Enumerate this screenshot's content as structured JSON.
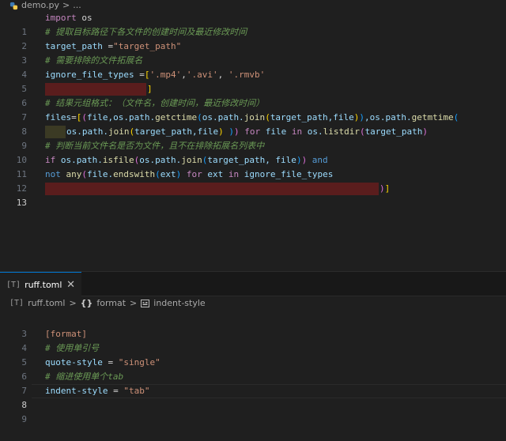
{
  "top_breadcrumb": {
    "file": "demo.py",
    "sep": ">",
    "more": "..."
  },
  "editor": {
    "lines": [
      {
        "n": "1"
      },
      {
        "n": "2"
      },
      {
        "n": "3"
      },
      {
        "n": "4"
      },
      {
        "n": "5"
      },
      {
        "n": "6"
      },
      {
        "n": "7"
      },
      {
        "n": "8"
      },
      {
        "n": "9"
      },
      {
        "n": "10"
      },
      {
        "n": "11"
      },
      {
        "n": "12"
      },
      {
        "n": "13"
      }
    ],
    "t": {
      "import": "import",
      "os": " os",
      "c2": "# 提取目标路径下各文件的创建时间及最近修改时间",
      "tp_var": "target_path ",
      "eq": "=",
      "tp_str": "\"target_path\"",
      "c4": "# 需要排除的文件拓展名",
      "ift": "ignore_file_types ",
      "eq2": "=",
      "lb": "[",
      "mp4": "'.mp4'",
      "comma": ",",
      "avi": "'.avi'",
      "comma2": ", ",
      "rmvb": "'.rmvb'",
      "rb": "]",
      "c7": "# 结果元组格式：（文件名，创建时间，最近修改时间）",
      "l8a": "files",
      "l8b": "=",
      "l8c": "[",
      "l8d": "(",
      "l8e": "file,os.path.",
      "l8f": "getctime",
      "l8g": "(",
      "l8h": "os.path.",
      "l8i": "join",
      "l8j": "(",
      "l8k": "target_path,file",
      "l8l": ")",
      "l8m": ")",
      "l8n": ",os.path.",
      "l8o": "getmtime",
      "l8p": "(",
      "l9a": "os.path.",
      "l9b": "join",
      "l9c": "(",
      "l9d": "target_path,file",
      "l9e": ")",
      "l9f": " )",
      "l9g": ")",
      "l9h": " for ",
      "l9i": "file",
      "l9j": " in ",
      "l9k": "os.",
      "l9l": "listdir",
      "l9m": "(",
      "l9n": "target_path",
      "l9o": ")",
      "c10": "# 判断当前文件名是否为文件，且不在排除拓展名列表中",
      "l11a": "if ",
      "l11b": "os.path.",
      "l11c": "isfile",
      "l11d": "(",
      "l11e": "os.path.",
      "l11f": "join",
      "l11g": "(",
      "l11h": "target_path, file",
      "l11i": ")",
      "l11j": ")",
      "l11k": " and",
      "l12a": "not ",
      "l12b": "any",
      "l12c": "(",
      "l12d": "file.",
      "l12e": "endswith",
      "l12f": "(",
      "l12g": "ext",
      "l12h": ")",
      "l12i": " for ",
      "l12j": "ext",
      "l12k": " in ",
      "l12l": "ignore_file_types",
      "l13a": ")",
      "l13b": "]"
    }
  },
  "bottom_tab": {
    "icon": "[T]",
    "label": "ruff.toml",
    "close": "✕"
  },
  "bottom_breadcrumb": {
    "icon": "[T]",
    "file": "ruff.toml",
    "sep1": ">",
    "section_icon": "{}",
    "section": "format",
    "sep2": ">",
    "item": "indent-style"
  },
  "toml": {
    "lines": [
      {
        "n": "3"
      },
      {
        "n": "4"
      },
      {
        "n": "5"
      },
      {
        "n": "6"
      },
      {
        "n": "7"
      },
      {
        "n": "8"
      },
      {
        "n": "9"
      }
    ],
    "format_header": "[format]",
    "c5": "# 使用单引号",
    "qs_key": "quote-style",
    "qs_eq": " = ",
    "qs_val": "\"single\"",
    "c7": "# 缩进使用单个tab",
    "is_key": "indent-style",
    "is_eq": " = ",
    "is_val": "\"tab\""
  }
}
